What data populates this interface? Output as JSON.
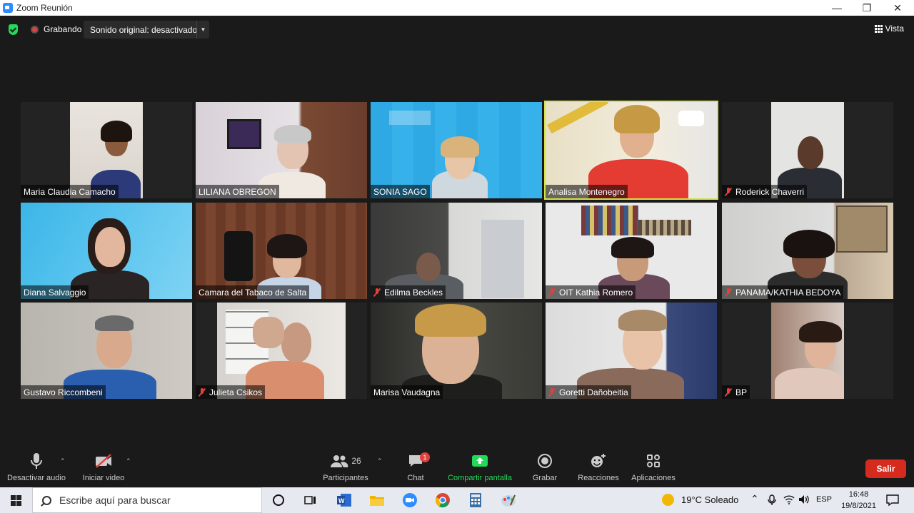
{
  "window": {
    "title": "Zoom Reunión"
  },
  "meeting_bar": {
    "recording_label": "Grabando",
    "sound_label": "Sonido original: desactivado",
    "view_label": "Vista"
  },
  "participants": [
    {
      "name": "Maria Claudia Camacho",
      "muted": false
    },
    {
      "name": "LILIANA OBREGON",
      "muted": false
    },
    {
      "name": "SONIA SAGO",
      "muted": false
    },
    {
      "name": "Analisa Montenegro",
      "muted": false,
      "active_speaker": true
    },
    {
      "name": "Roderick Chaverri",
      "muted": true
    },
    {
      "name": "Diana Salvaggio",
      "muted": false
    },
    {
      "name": "Camara del Tabaco de Salta",
      "muted": false
    },
    {
      "name": "Edilma Beckles",
      "muted": true
    },
    {
      "name": "OIT Kathia Romero",
      "muted": true
    },
    {
      "name": "PANAMA/KATHIA BEDOYA",
      "muted": true
    },
    {
      "name": "Gustavo Riccombeni",
      "muted": false
    },
    {
      "name": "Julieta Csikos",
      "muted": true
    },
    {
      "name": "Marisa Vaudagna",
      "muted": false
    },
    {
      "name": "Goretti Dañobeitia",
      "muted": true
    },
    {
      "name": "BP",
      "muted": true
    }
  ],
  "toolbar": {
    "mute_label": "Desactivar audio",
    "video_label": "Iniciar video",
    "participants_label": "Participantes",
    "participants_count": "26",
    "chat_label": "Chat",
    "chat_badge": "1",
    "share_label": "Compartir pantalla",
    "record_label": "Grabar",
    "reactions_label": "Reacciones",
    "apps_label": "Aplicaciones",
    "exit_label": "Salir"
  },
  "taskbar": {
    "search_placeholder": "Escribe aquí para buscar",
    "weather": "19°C  Soleado",
    "language": "ESP",
    "time": "16:48",
    "date": "19/8/2021"
  },
  "colors": {
    "active_speaker_border": "#d2e34a",
    "exit_button": "#d52b1e",
    "share_icon": "#23d959",
    "muted_icon": "#e0413d"
  }
}
